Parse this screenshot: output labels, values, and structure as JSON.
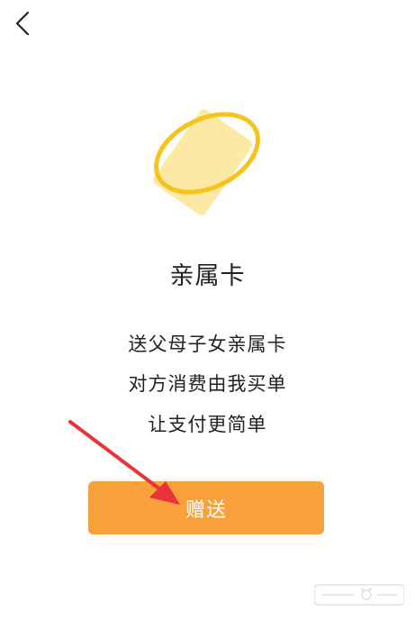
{
  "header": {
    "back_icon": "chevron-left-icon"
  },
  "hero": {
    "icon": "card-orbit-icon",
    "card_color": "#fce9a4",
    "ring_color": "#f6c21b"
  },
  "main": {
    "title": "亲属卡",
    "lines": [
      "送父母子女亲属卡",
      "对方消费由我买单",
      "让支付更简单"
    ]
  },
  "action": {
    "gift_label": "赠送",
    "color": "#f8a03a"
  },
  "annotation": {
    "arrow_color": "#e8333a"
  }
}
